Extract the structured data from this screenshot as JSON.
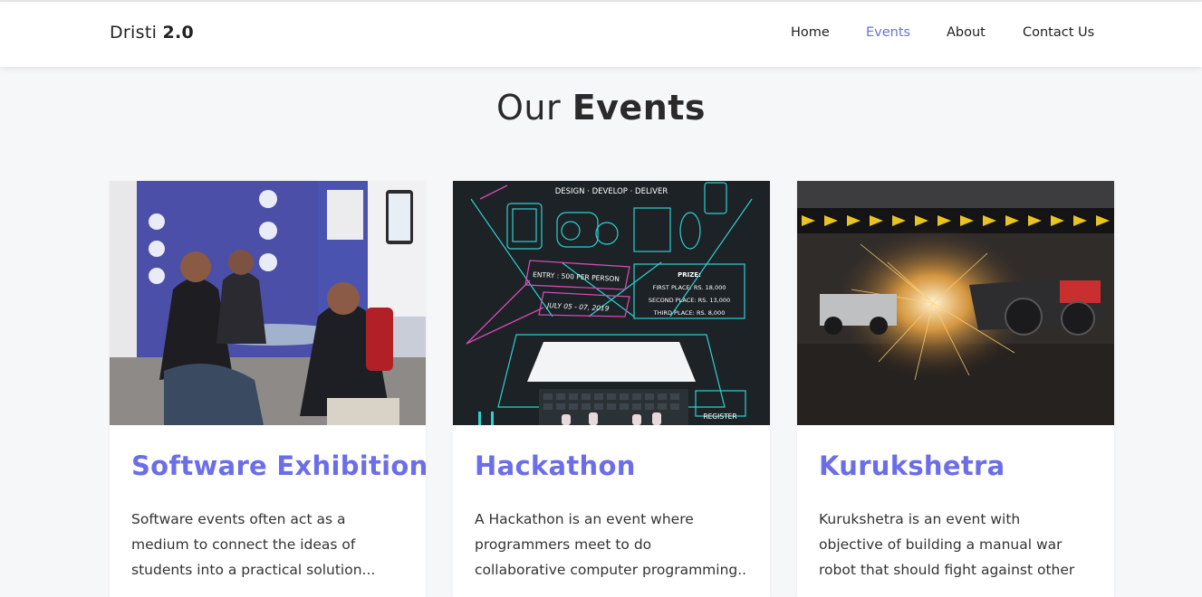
{
  "brand": {
    "name_light": "Dristi",
    "name_bold": "2.0"
  },
  "nav": {
    "items": [
      {
        "label": "Home",
        "active": false
      },
      {
        "label": "Events",
        "active": true
      },
      {
        "label": "About",
        "active": false
      },
      {
        "label": "Contact Us",
        "active": false
      }
    ]
  },
  "section": {
    "title_light": "Our",
    "title_bold": "Events"
  },
  "colors": {
    "accent": "#6b6ee8",
    "page_bg": "#f6f7f9",
    "text": "#333333"
  },
  "events": [
    {
      "title": "Software Exhibition",
      "image_icon": "exhibition-photo",
      "description_lines": [
        "Software events often act as a",
        "medium to connect the ideas of",
        "students into a practical solution..."
      ]
    },
    {
      "title": "Hackathon",
      "image_icon": "hackathon-poster",
      "poster": {
        "tagline": "DESIGN · DEVELOP · DELIVER",
        "entry": "ENTRY : 500 PER PERSON",
        "date": "JULY 05 - 07, 2019",
        "prize_title": "PRIZE:",
        "prize_first": "FIRST PLACE: RS. 18,000",
        "prize_second": "SECOND PLACE: RS. 13,000",
        "prize_third": "THIRD PLACE: RS. 8,000",
        "register": "REGISTER"
      },
      "description_lines": [
        "A Hackathon is an event where",
        "programmers meet to do",
        "collaborative computer programming.."
      ]
    },
    {
      "title": "Kurukshetra",
      "image_icon": "robot-battle-photo",
      "description_lines": [
        "Kurukshetra is an event with",
        "objective of building a manual war",
        "robot that should fight against other"
      ]
    }
  ]
}
